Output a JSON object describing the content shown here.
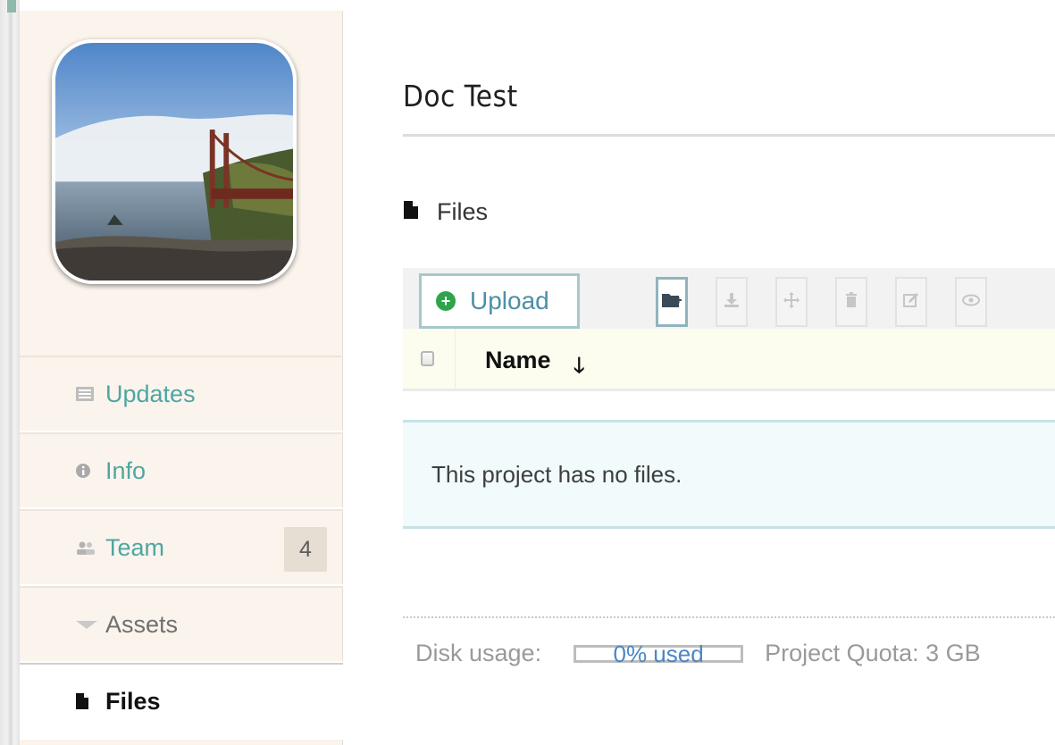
{
  "project": {
    "title": "Doc Test"
  },
  "sidebar": {
    "items": [
      {
        "label": "Updates",
        "icon": "newspaper-icon"
      },
      {
        "label": "Info",
        "icon": "info-icon"
      },
      {
        "label": "Team",
        "icon": "team-icon",
        "badge": "4"
      },
      {
        "label": "Assets",
        "icon": "caret-down-icon"
      },
      {
        "label": "Files",
        "icon": "file-icon",
        "active": true
      }
    ]
  },
  "files": {
    "section_title": "Files",
    "toolbar": {
      "upload_label": "Upload",
      "tools": [
        "new-folder-icon",
        "download-icon",
        "move-icon",
        "delete-icon",
        "edit-icon",
        "view-icon"
      ]
    },
    "columns": {
      "name": "Name"
    },
    "sort_direction": "descending",
    "empty_message": "This project has no files."
  },
  "footer": {
    "disk_usage_label": "Disk usage:",
    "usage_text": "0% used",
    "usage_fraction": 0,
    "quota_text": "Project Quota: 3 GB"
  },
  "colors": {
    "link": "#4ea6a2",
    "upload_text": "#4c8fa8",
    "upload_plus": "#2fa54b",
    "sidebar_bg": "#fbf4ec",
    "empty_bg": "#f1fbfc"
  }
}
